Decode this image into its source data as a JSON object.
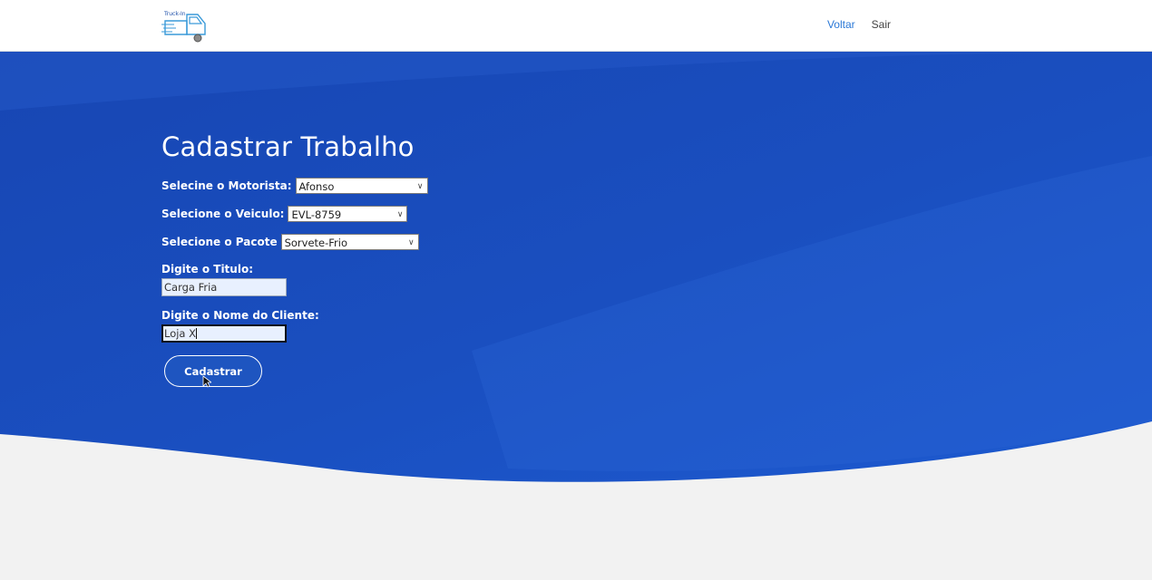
{
  "header": {
    "logo_text": "Truck-In",
    "nav": {
      "back": "Voltar",
      "logout": "Sair"
    }
  },
  "form": {
    "title": "Cadastrar Trabalho",
    "driver": {
      "label": "Selecine o Motorista:",
      "selected": "Afonso"
    },
    "vehicle": {
      "label": "Selecione o Veiculo:",
      "selected": "EVL-8759"
    },
    "package": {
      "label": "Selecione o Pacote",
      "selected": "Sorvete-Frio"
    },
    "title_field": {
      "label": "Digite o Titulo:",
      "value": "Carga Fria"
    },
    "client_field": {
      "label": "Digite o Nome do Cliente:",
      "value": "Loja X"
    },
    "submit_label": "Cadastrar"
  },
  "colors": {
    "hero_blue": "#1a4bb8",
    "nav_active": "#2a78d6",
    "footer_gray": "#f2f2f2"
  }
}
